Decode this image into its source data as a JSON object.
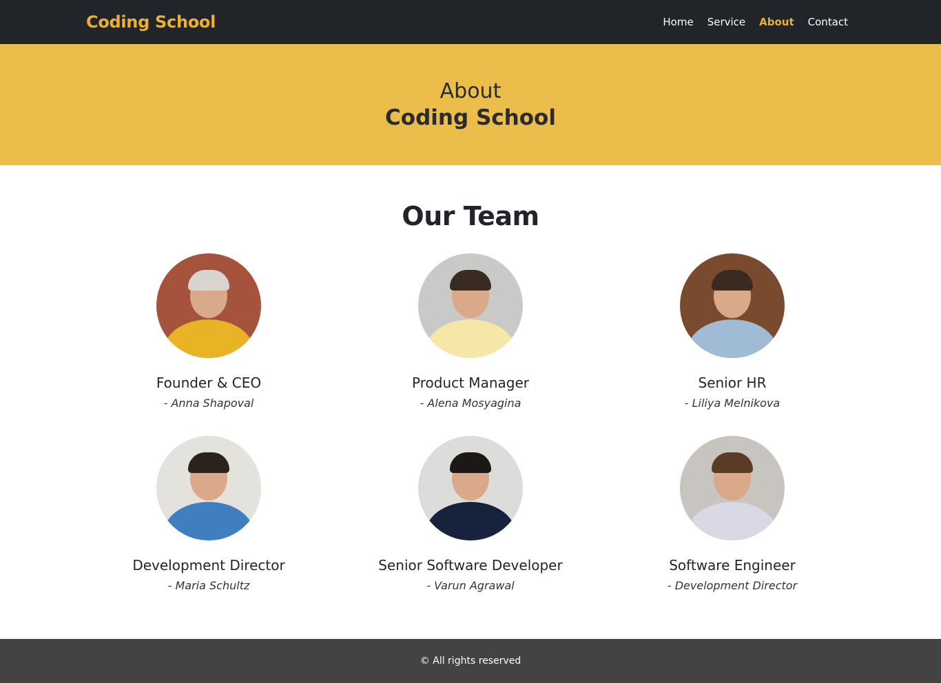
{
  "nav": {
    "brand": "Coding School",
    "links": [
      {
        "label": "Home",
        "active": false
      },
      {
        "label": "Service",
        "active": false
      },
      {
        "label": "About",
        "active": true
      },
      {
        "label": "Contact",
        "active": false
      }
    ]
  },
  "hero": {
    "line1": "About",
    "line2": "Coding School"
  },
  "team": {
    "title": "Our Team",
    "members": [
      {
        "role": "Founder & CEO",
        "name": "- Anna Shapoval",
        "bg": "#a5533d",
        "shirt": "#e8b426",
        "hair": "#d8d4cf"
      },
      {
        "role": "Product Manager",
        "name": "- Alena Mosyagina",
        "bg": "#c9c9c7",
        "shirt": "#f6e6a8",
        "hair": "#3a2b22"
      },
      {
        "role": "Senior HR",
        "name": "- Liliya Melnikova",
        "bg": "#7a4a2e",
        "shirt": "#9fbbd6",
        "hair": "#3b2a20"
      },
      {
        "role": "Development Director",
        "name": "- Maria Schultz",
        "bg": "#e4e2dc",
        "shirt": "#3f7fbf",
        "hair": "#2b221c"
      },
      {
        "role": "Senior Software Developer",
        "name": "- Varun Agrawal",
        "bg": "#dcdcda",
        "shirt": "#17233d",
        "hair": "#1b1816"
      },
      {
        "role": "Software Engineer",
        "name": "- Development Director",
        "bg": "#c8c4bf",
        "shirt": "#d9d9e6",
        "hair": "#5a3b26"
      }
    ]
  },
  "footer": {
    "text": "© All rights reserved"
  },
  "colors": {
    "accent": "#ecb02e",
    "hero_bg": "#ebbe4b",
    "navbar_bg": "#212529",
    "footer_bg": "#434343"
  }
}
